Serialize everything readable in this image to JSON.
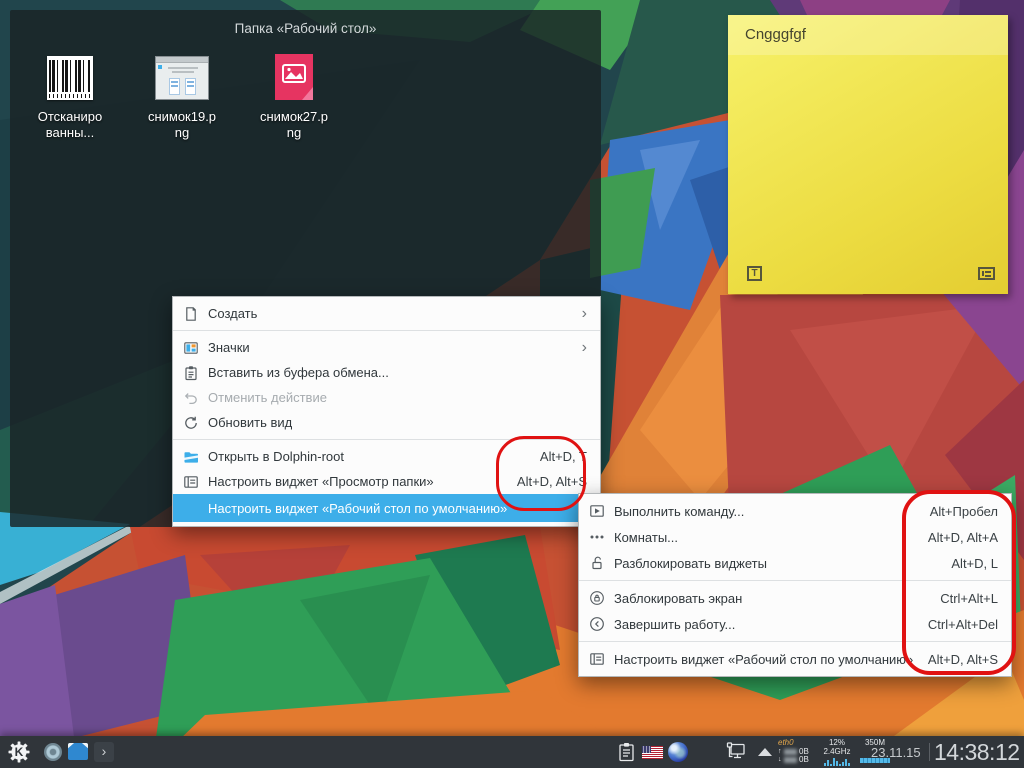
{
  "desktop": {
    "folder_widget": {
      "title": "Папка «Рабочий стол»",
      "items": [
        {
          "label": "Отсканиро\nванны...",
          "icon": "barcode-thumbnail"
        },
        {
          "label": "снимок19.p\nng",
          "icon": "window-screenshot-thumbnail"
        },
        {
          "label": "снимок27.p\nng",
          "icon": "image-file-icon"
        }
      ]
    },
    "sticky_note": {
      "text": "Cngggfgf",
      "color": "#ecdc41"
    }
  },
  "menu1": {
    "items": [
      {
        "label": "Создать",
        "icon": "document-new-icon",
        "has_submenu": true
      },
      {
        "label": "Значки",
        "icon": "icon-view-icon",
        "has_submenu": true
      },
      {
        "label": "Вставить из буфера обмена...",
        "icon": "clipboard-icon"
      },
      {
        "label": "Отменить действие",
        "icon": "undo-icon",
        "disabled": true
      },
      {
        "label": "Обновить вид",
        "icon": "refresh-icon"
      },
      {
        "label": "Открыть в Dolphin-root",
        "icon": "folder-open-icon",
        "shortcut": "Alt+D, T"
      },
      {
        "label": "Настроить виджет «Просмотр папки»",
        "icon": "configure-widget-icon",
        "shortcut": "Alt+D, Alt+S"
      },
      {
        "label": "Настроить виджет «Рабочий стол по умолчанию»",
        "highlighted": true
      }
    ]
  },
  "menu2": {
    "items": [
      {
        "label": "Выполнить команду...",
        "icon": "run-command-icon",
        "shortcut": "Alt+Пробел"
      },
      {
        "label": "Комнаты...",
        "icon": "activities-icon",
        "shortcut": "Alt+D, Alt+A"
      },
      {
        "label": "Разблокировать виджеты",
        "icon": "unlock-icon",
        "shortcut": "Alt+D, L"
      },
      {
        "label": "Заблокировать экран",
        "icon": "lock-screen-icon",
        "shortcut": "Ctrl+Alt+L"
      },
      {
        "label": "Завершить работу...",
        "icon": "shutdown-icon",
        "shortcut": "Ctrl+Alt+Del"
      },
      {
        "label": "Настроить виджет «Рабочий стол по умолчанию»",
        "icon": "configure-widget-icon",
        "shortcut": "Alt+D, Alt+S"
      }
    ]
  },
  "taskbar": {
    "sysmon": {
      "iface": "eth0",
      "upload": "0B",
      "download": "0B",
      "cpu_percent": "12%",
      "cpu_freq": "2.4GHz",
      "memory": "350M"
    },
    "date": "23.11.15",
    "time": "14:38:12"
  },
  "colors": {
    "highlight": "#3daee9",
    "annotation": "#e01212",
    "panel": "#30353a",
    "menu_bg": "#fcfcfc",
    "note_yellow": "#ecdc41"
  }
}
